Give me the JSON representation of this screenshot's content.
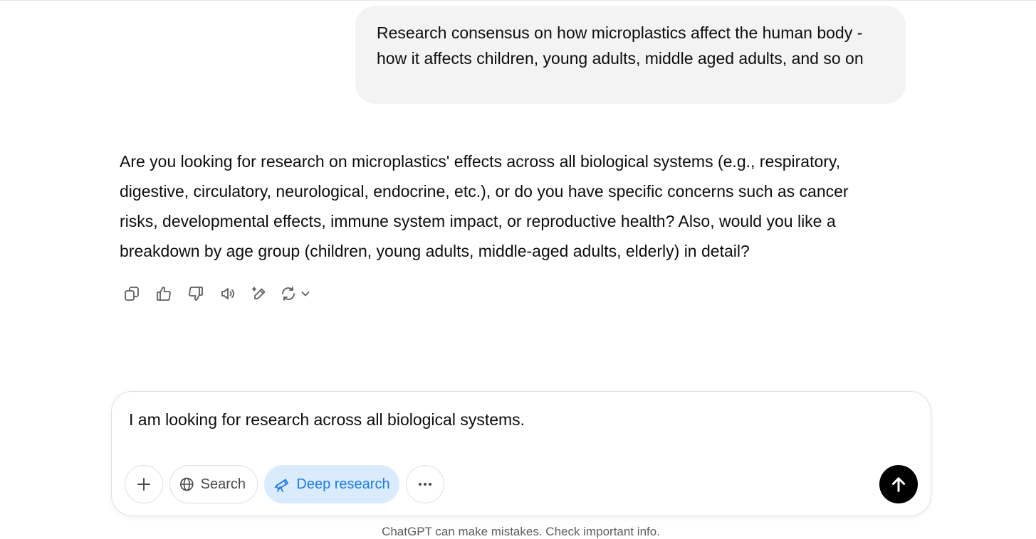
{
  "conversation": {
    "user_message": "Research consensus on how microplastics affect the human body - how it affects children, young adults, middle aged adults, and so on",
    "assistant_message": "Are you looking for research on microplastics' effects across all biological systems (e.g., respiratory, digestive, circulatory, neurological, endocrine, etc.), or do you have specific concerns such as cancer risks, developmental effects, immune system impact, or reproductive health? Also, would you like a breakdown by age group (children, young adults, middle-aged adults, elderly) in detail?"
  },
  "message_actions": {
    "icons": [
      "copy-icon",
      "thumbs-up-icon",
      "thumbs-down-icon",
      "read-aloud-icon",
      "edit-icon",
      "regenerate-icon",
      "chevron-down-icon"
    ]
  },
  "composer": {
    "input_value": "I am looking for research across all biological systems.",
    "search_label": "Search",
    "deep_research_label": "Deep research"
  },
  "footer": {
    "disclaimer": "ChatGPT can make mistakes. Check important info."
  },
  "colors": {
    "deep_research_bg": "#d9ebfc",
    "deep_research_text": "#1e7ce6",
    "send_button": "#000000",
    "user_bubble": "#f3f3f3"
  }
}
